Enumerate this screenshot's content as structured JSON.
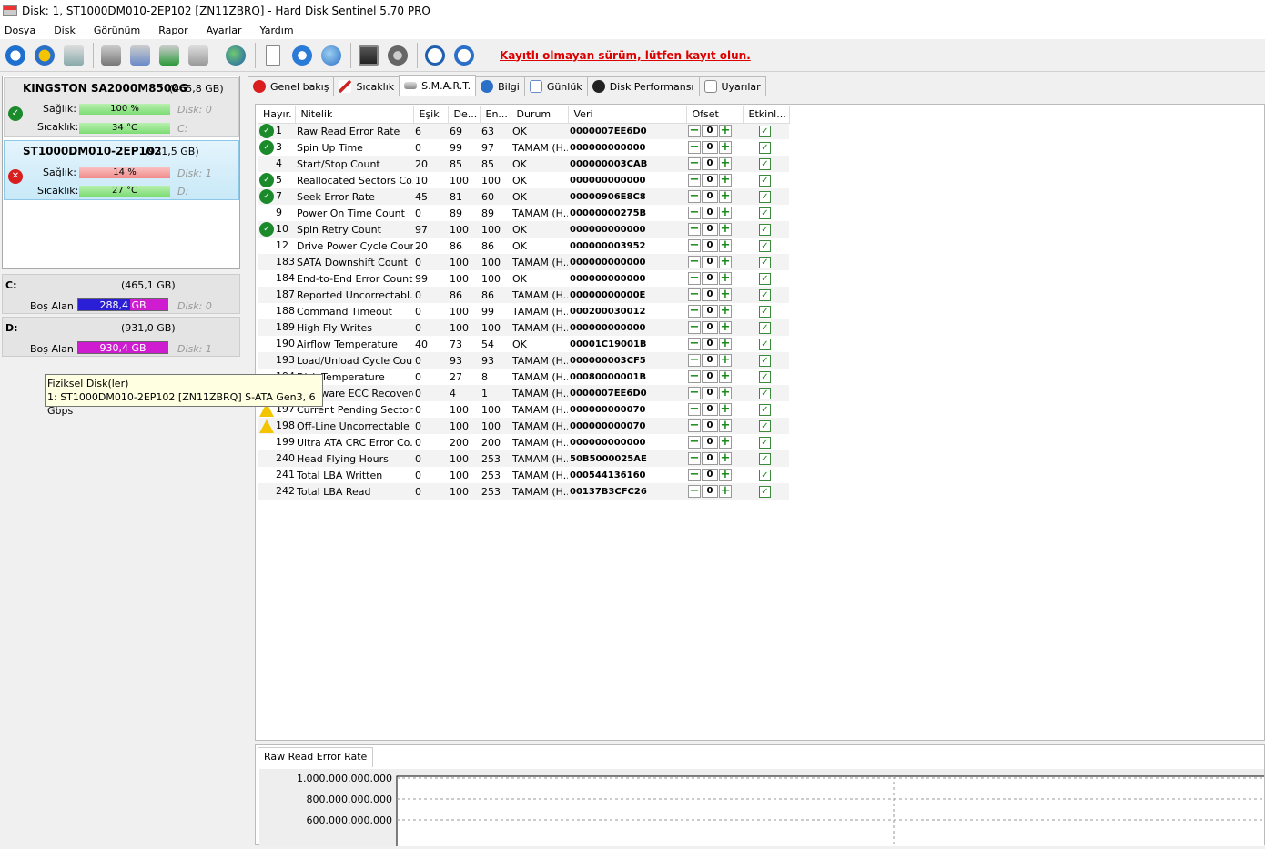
{
  "window": {
    "title": "Disk: 1, ST1000DM010-2EP102 [ZN11ZBRQ]  -  Hard Disk Sentinel 5.70 PRO"
  },
  "menu": [
    "Dosya",
    "Disk",
    "Görünüm",
    "Rapor",
    "Ayarlar",
    "Yardım"
  ],
  "toolbar": {
    "registration_warning": "Kayıtlı olmayan sürüm, lütfen kayıt olun."
  },
  "disks": [
    {
      "name": "KINGSTON SA2000M8500G",
      "size": "(465,8 GB)",
      "health_label": "Sağlık:",
      "health": "100 %",
      "health_fraction": 1.0,
      "disk_note": "Disk: 0",
      "temp_label": "Sıcaklık:",
      "temp": "34 °C",
      "drive": "C:",
      "status": "ok"
    },
    {
      "name": "ST1000DM010-2EP102",
      "size": "(931,5 GB)",
      "health_label": "Sağlık:",
      "health": "14 %",
      "health_fraction": 0.14,
      "disk_note": "Disk: 1",
      "temp_label": "Sıcaklık:",
      "temp": "27 °C",
      "drive": "D:",
      "status": "error"
    }
  ],
  "volumes": [
    {
      "letter": "C:",
      "size": "(465,1 GB)",
      "free_label": "Boş Alan",
      "free": "288,4 GB",
      "disk": "Disk: 0",
      "color": "#2a1fd6"
    },
    {
      "letter": "D:",
      "size": "(931,0 GB)",
      "free_label": "Boş Alan",
      "free": "930,4 GB",
      "disk": "Disk: 1",
      "color": "#d01cd0"
    }
  ],
  "tooltip": {
    "line1": "Fiziksel Disk(ler)",
    "line2": "1: ST1000DM010-2EP102 [ZN11ZBRQ] S-ATA Gen3, 6 Gbps"
  },
  "tabs": [
    "Genel bakış",
    "Sıcaklık",
    "S.M.A.R.T.",
    "Bilgi",
    "Günlük",
    "Disk Performansı",
    "Uyarılar"
  ],
  "smart": {
    "headers": [
      "Hayır.",
      "Nitelik",
      "Eşik",
      "De...",
      "En...",
      "Durum",
      "Veri",
      "Ofset",
      "Etkinl..."
    ],
    "rows": [
      {
        "icon": "ok",
        "id": "1",
        "name": "Raw Read Error Rate",
        "th": "6",
        "val": "69",
        "worst": "63",
        "status": "OK",
        "data": "0000007EE6D0"
      },
      {
        "icon": "ok",
        "id": "3",
        "name": "Spin Up Time",
        "th": "0",
        "val": "99",
        "worst": "97",
        "status": "TAMAM (H...",
        "data": "000000000000"
      },
      {
        "icon": "",
        "id": "4",
        "name": "Start/Stop Count",
        "th": "20",
        "val": "85",
        "worst": "85",
        "status": "OK",
        "data": "000000003CAB"
      },
      {
        "icon": "ok",
        "id": "5",
        "name": "Reallocated Sectors Co...",
        "th": "10",
        "val": "100",
        "worst": "100",
        "status": "OK",
        "data": "000000000000"
      },
      {
        "icon": "ok",
        "id": "7",
        "name": "Seek Error Rate",
        "th": "45",
        "val": "81",
        "worst": "60",
        "status": "OK",
        "data": "00000906E8C8"
      },
      {
        "icon": "",
        "id": "9",
        "name": "Power On Time Count",
        "th": "0",
        "val": "89",
        "worst": "89",
        "status": "TAMAM (H...",
        "data": "00000000275B"
      },
      {
        "icon": "ok",
        "id": "10",
        "name": "Spin Retry Count",
        "th": "97",
        "val": "100",
        "worst": "100",
        "status": "OK",
        "data": "000000000000"
      },
      {
        "icon": "",
        "id": "12",
        "name": "Drive Power Cycle Count",
        "th": "20",
        "val": "86",
        "worst": "86",
        "status": "OK",
        "data": "000000003952"
      },
      {
        "icon": "",
        "id": "183",
        "name": "SATA Downshift Count",
        "th": "0",
        "val": "100",
        "worst": "100",
        "status": "TAMAM (H...",
        "data": "000000000000"
      },
      {
        "icon": "",
        "id": "184",
        "name": "End-to-End Error Count",
        "th": "99",
        "val": "100",
        "worst": "100",
        "status": "OK",
        "data": "000000000000"
      },
      {
        "icon": "",
        "id": "187",
        "name": "Reported Uncorrectabl...",
        "th": "0",
        "val": "86",
        "worst": "86",
        "status": "TAMAM (H...",
        "data": "00000000000E"
      },
      {
        "icon": "",
        "id": "188",
        "name": "Command Timeout",
        "th": "0",
        "val": "100",
        "worst": "99",
        "status": "TAMAM (H...",
        "data": "000200030012"
      },
      {
        "icon": "",
        "id": "189",
        "name": "High Fly Writes",
        "th": "0",
        "val": "100",
        "worst": "100",
        "status": "TAMAM (H...",
        "data": "000000000000"
      },
      {
        "icon": "",
        "id": "190",
        "name": "Airflow Temperature",
        "th": "40",
        "val": "73",
        "worst": "54",
        "status": "OK",
        "data": "00001C19001B"
      },
      {
        "icon": "",
        "id": "193",
        "name": "Load/Unload Cycle Cou...",
        "th": "0",
        "val": "93",
        "worst": "93",
        "status": "TAMAM (H...",
        "data": "000000003CF5"
      },
      {
        "icon": "",
        "id": "194",
        "name": "Disk Temperature",
        "th": "0",
        "val": "27",
        "worst": "8",
        "status": "TAMAM (H...",
        "data": "00080000001B"
      },
      {
        "icon": "",
        "id": "195",
        "name": "Hardware ECC Recovered",
        "th": "0",
        "val": "4",
        "worst": "1",
        "status": "TAMAM (H...",
        "data": "0000007EE6D0"
      },
      {
        "icon": "warn",
        "id": "197",
        "name": "Current Pending Sector...",
        "th": "0",
        "val": "100",
        "worst": "100",
        "status": "TAMAM (H...",
        "data": "000000000070"
      },
      {
        "icon": "warn",
        "id": "198",
        "name": "Off-Line Uncorrectable ...",
        "th": "0",
        "val": "100",
        "worst": "100",
        "status": "TAMAM (H...",
        "data": "000000000070"
      },
      {
        "icon": "",
        "id": "199",
        "name": "Ultra ATA CRC Error Co...",
        "th": "0",
        "val": "200",
        "worst": "200",
        "status": "TAMAM (H...",
        "data": "000000000000"
      },
      {
        "icon": "",
        "id": "240",
        "name": "Head Flying Hours",
        "th": "0",
        "val": "100",
        "worst": "253",
        "status": "TAMAM (H...",
        "data": "50B5000025AE"
      },
      {
        "icon": "",
        "id": "241",
        "name": "Total LBA Written",
        "th": "0",
        "val": "100",
        "worst": "253",
        "status": "TAMAM (H...",
        "data": "000544136160"
      },
      {
        "icon": "",
        "id": "242",
        "name": "Total LBA Read",
        "th": "0",
        "val": "100",
        "worst": "253",
        "status": "TAMAM (H...",
        "data": "00137B3CFC26"
      }
    ],
    "offset_value": "0"
  },
  "chart": {
    "tab_label": "Raw Read Error Rate",
    "y_ticks": [
      "1.000.000.000.000",
      "800.000.000.000",
      "600.000.000.000"
    ]
  }
}
